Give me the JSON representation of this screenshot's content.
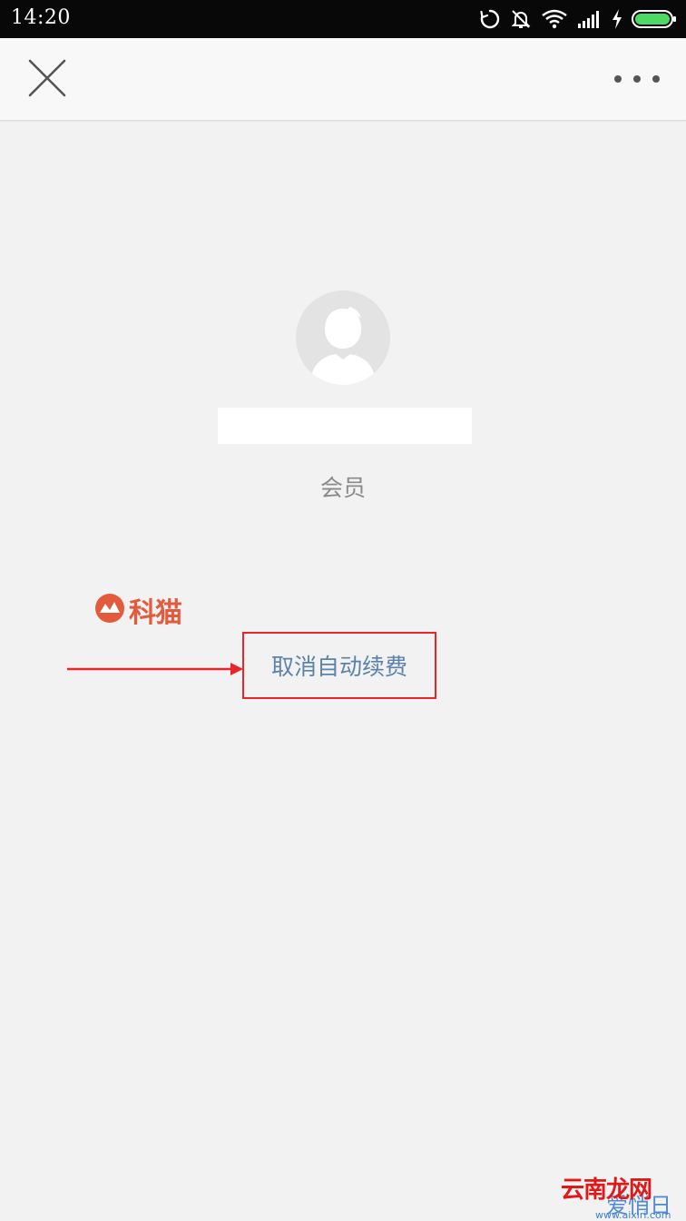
{
  "status_bar": {
    "time": "14:20",
    "icons": [
      "sync-icon",
      "bell-off-icon",
      "wifi-icon",
      "signal-icon",
      "charging-icon",
      "battery-icon"
    ]
  },
  "nav": {
    "close_icon": "close-icon",
    "more_icon": "more-icon"
  },
  "profile": {
    "avatar_icon": "avatar-placeholder-icon",
    "member_label": "会员"
  },
  "watermark": {
    "text": "科猫"
  },
  "actions": {
    "cancel_auto_renew": "取消自动续费"
  },
  "annotation": {
    "color": "#e8262a"
  },
  "corner_watermark": {
    "title": "云南龙网",
    "sub": "爱悄日",
    "url": "www.aixiri.com"
  },
  "colors": {
    "link": "#5b82ab",
    "background": "#f2f2f2",
    "status_bar": "#080808",
    "battery": "#4cd964"
  }
}
